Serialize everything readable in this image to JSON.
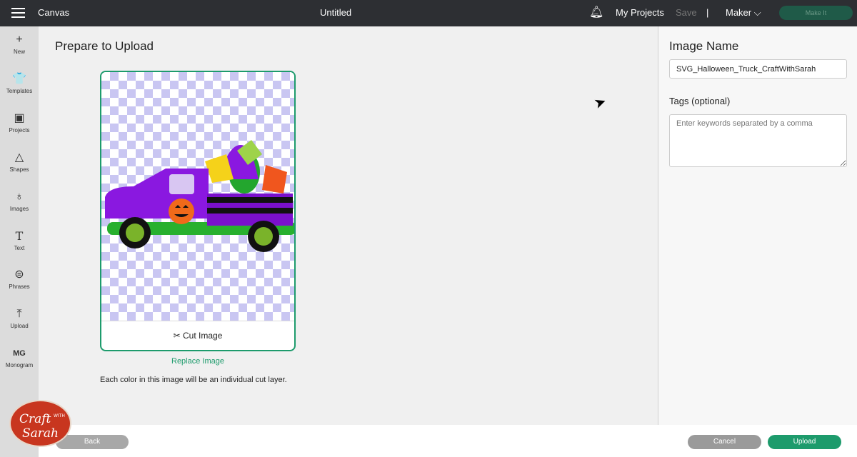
{
  "topbar": {
    "app": "Canvas",
    "title": "Untitled",
    "my_projects": "My Projects",
    "save": "Save",
    "separator": "|",
    "machine": "Maker",
    "make_it": "Make It"
  },
  "sidebar": {
    "items": [
      {
        "label": "New",
        "icon": "+"
      },
      {
        "label": "Templates",
        "icon": "👕"
      },
      {
        "label": "Projects",
        "icon": "▣"
      },
      {
        "label": "Shapes",
        "icon": "△"
      },
      {
        "label": "Images",
        "icon": "♁"
      },
      {
        "label": "Text",
        "icon": "T"
      },
      {
        "label": "Phrases",
        "icon": "⊜"
      },
      {
        "label": "Upload",
        "icon": "⤒"
      },
      {
        "label": "Monogram",
        "icon": "MG"
      }
    ]
  },
  "main": {
    "title": "Prepare to Upload",
    "cut_image": "Cut Image",
    "replace_image": "Replace Image",
    "note": "Each color in this image will be an individual cut layer."
  },
  "right": {
    "image_name_label": "Image Name",
    "image_name_value": "SVG_Halloween_Truck_CraftWithSarah",
    "tags_label": "Tags (optional)",
    "tags_placeholder": "Enter keywords separated by a comma"
  },
  "footer": {
    "back": "Back",
    "cancel": "Cancel",
    "upload": "Upload"
  },
  "watermark": {
    "text": "Craft with Sarah"
  },
  "colors": {
    "accent": "#1d9b6c",
    "topbar": "#2d2f33",
    "truck": "#8a18e0"
  }
}
